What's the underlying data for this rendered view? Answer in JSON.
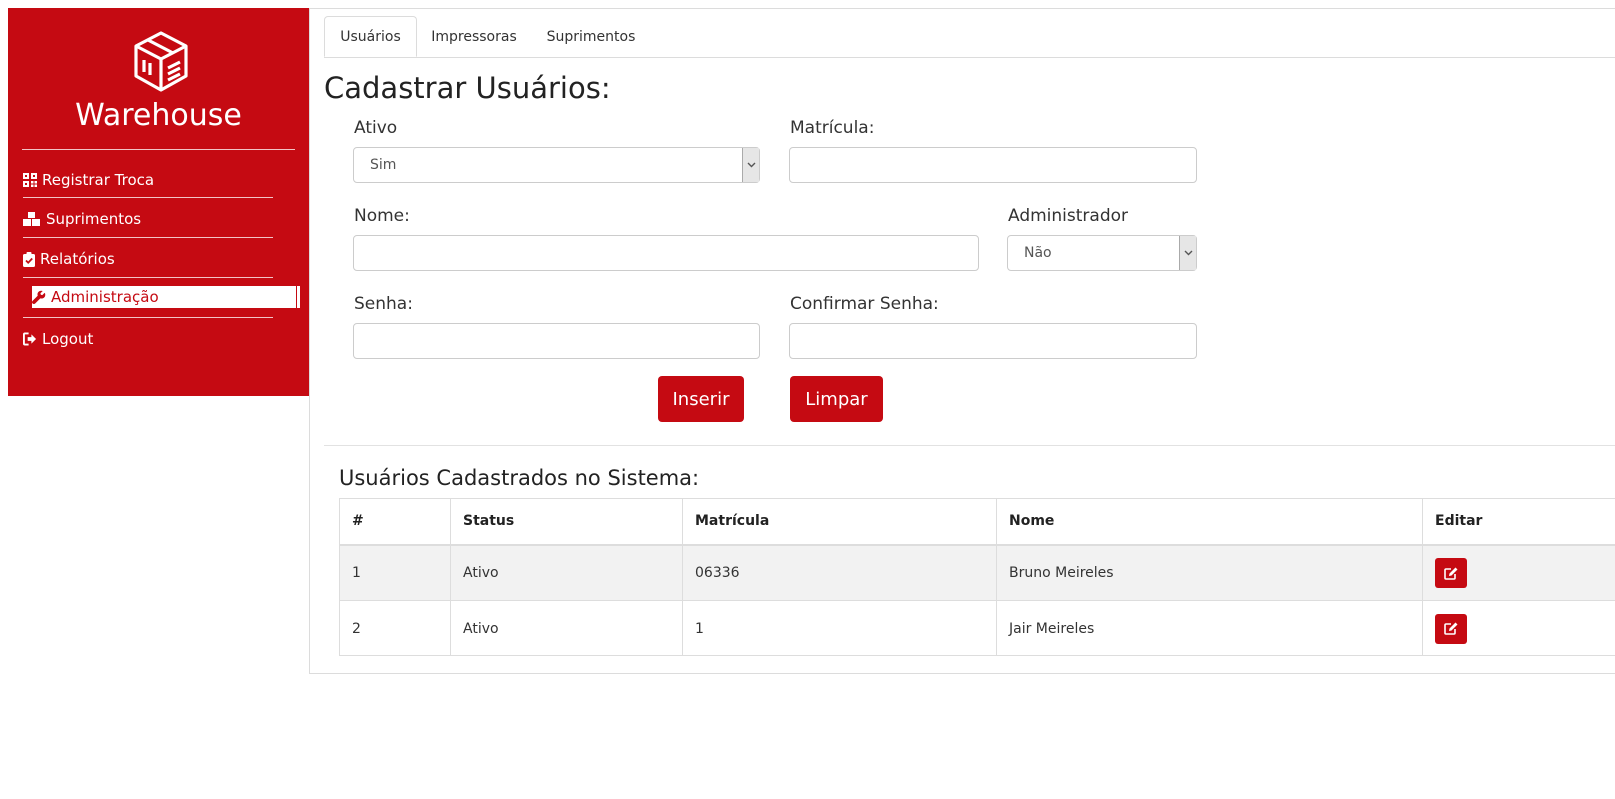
{
  "sidebar": {
    "brand": "Warehouse",
    "accent": "#c50a12",
    "items": [
      {
        "label": "Registrar Troca",
        "icon": "qrcode-icon"
      },
      {
        "label": "Suprimentos",
        "icon": "boxes-icon"
      },
      {
        "label": "Relatórios",
        "icon": "clipboard-check-icon"
      },
      {
        "label": "Administração",
        "icon": "wrench-icon"
      },
      {
        "label": "Logout",
        "icon": "sign-out-icon"
      }
    ]
  },
  "tabs": [
    {
      "label": "Usuários"
    },
    {
      "label": "Impressoras"
    },
    {
      "label": "Suprimentos"
    }
  ],
  "form": {
    "title": "Cadastrar Usuários:",
    "ativo_label": "Ativo",
    "ativo_value": "Sim",
    "matricula_label": "Matrícula:",
    "matricula_value": "",
    "nome_label": "Nome:",
    "nome_value": "",
    "admin_label": "Administrador",
    "admin_value": "Não",
    "senha_label": "Senha:",
    "senha_value": "",
    "confirmar_label": "Confirmar Senha:",
    "confirmar_value": "",
    "inserir": "Inserir",
    "limpar": "Limpar"
  },
  "table": {
    "title": "Usuários Cadastrados no Sistema:",
    "headers": [
      "#",
      "Status",
      "Matrícula",
      "Nome",
      "Editar"
    ],
    "rows": [
      {
        "id": "1",
        "status": "Ativo",
        "matricula": "06336",
        "nome": "Bruno Meireles"
      },
      {
        "id": "2",
        "status": "Ativo",
        "matricula": "1",
        "nome": "Jair Meireles"
      }
    ]
  }
}
